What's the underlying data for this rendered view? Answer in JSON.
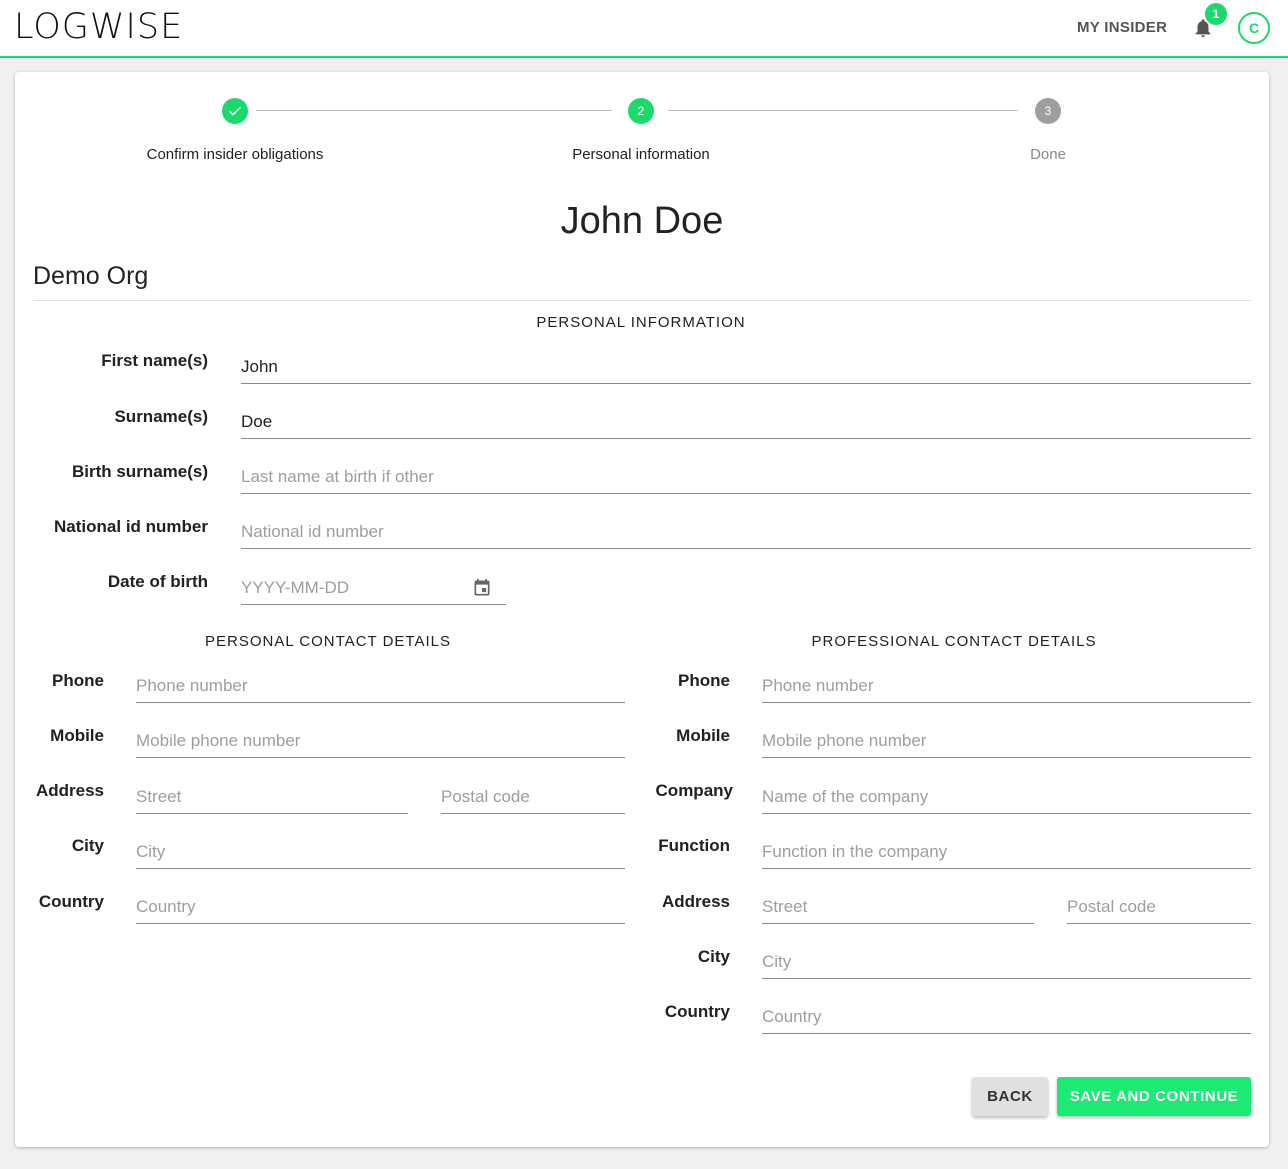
{
  "header": {
    "logo": "LOGWISE",
    "my_insider": "MY INSIDER",
    "notification_count": "1",
    "avatar_initial": "C",
    "accent": "#1bd96c"
  },
  "stepper": {
    "steps": [
      {
        "label": "Confirm insider obligations",
        "state": "complete",
        "icon": "check-icon"
      },
      {
        "label": "Personal information",
        "number": "2",
        "state": "active"
      },
      {
        "label": "Done",
        "number": "3",
        "state": "pending"
      }
    ]
  },
  "person_name": "John Doe",
  "org_name": "Demo Org",
  "personal_information": {
    "title": "PERSONAL INFORMATION",
    "first_name": {
      "label": "First name(s)",
      "value": "John"
    },
    "surname": {
      "label": "Surname(s)",
      "value": "Doe"
    },
    "birth_surname": {
      "label": "Birth surname(s)",
      "placeholder": "Last name at birth if other"
    },
    "national_id": {
      "label": "National id number",
      "placeholder": "National id number"
    },
    "date_of_birth": {
      "label": "Date of birth",
      "placeholder": "YYYY-MM-DD",
      "icon": "calendar-icon"
    }
  },
  "personal_contact": {
    "title": "PERSONAL CONTACT DETAILS",
    "phone": {
      "label": "Phone",
      "placeholder": "Phone number"
    },
    "mobile": {
      "label": "Mobile",
      "placeholder": "Mobile phone number"
    },
    "address": {
      "label": "Address",
      "street_placeholder": "Street",
      "postal_placeholder": "Postal code"
    },
    "city": {
      "label": "City",
      "placeholder": "City"
    },
    "country": {
      "label": "Country",
      "placeholder": "Country"
    }
  },
  "professional_contact": {
    "title": "PROFESSIONAL CONTACT DETAILS",
    "phone": {
      "label": "Phone",
      "placeholder": "Phone number"
    },
    "mobile": {
      "label": "Mobile",
      "placeholder": "Mobile phone number"
    },
    "company": {
      "label": "Company",
      "placeholder": "Name of the company"
    },
    "function": {
      "label": "Function",
      "placeholder": "Function in the company"
    },
    "address": {
      "label": "Address",
      "street_placeholder": "Street",
      "postal_placeholder": "Postal code"
    },
    "city": {
      "label": "City",
      "placeholder": "City"
    },
    "country": {
      "label": "Country",
      "placeholder": "Country"
    }
  },
  "actions": {
    "back": "BACK",
    "save": "SAVE AND CONTINUE"
  }
}
